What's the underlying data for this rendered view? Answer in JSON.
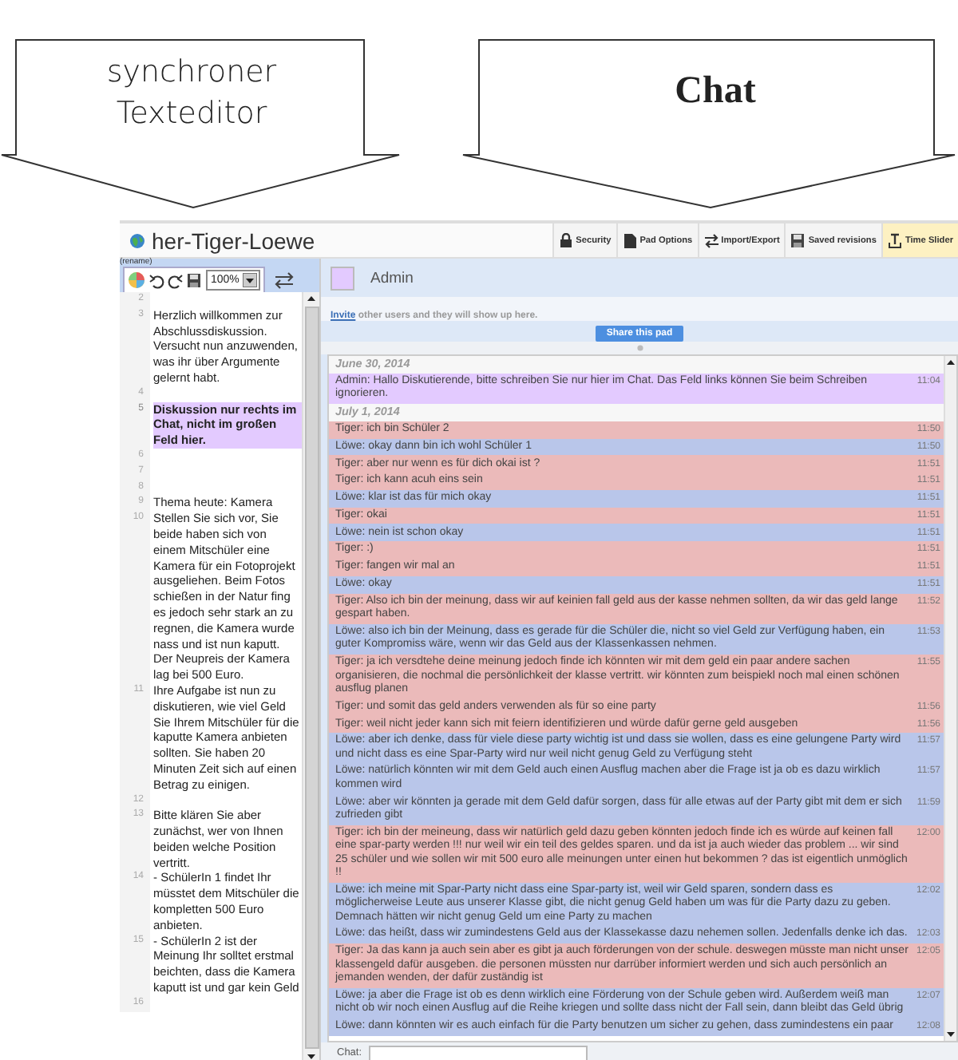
{
  "callouts": [
    {
      "label": "synchroner Texteditor",
      "kind": "plain"
    },
    {
      "label": "Chat",
      "kind": "bold"
    }
  ],
  "pad": {
    "title": "her-Tiger-Loewe",
    "toolbar": [
      {
        "label": "Security",
        "active": false
      },
      {
        "label": "Pad Options",
        "active": false
      },
      {
        "label": "Import/Export",
        "active": false
      },
      {
        "label": "Saved revisions",
        "active": false
      },
      {
        "label": "Time Slider",
        "active": true
      }
    ]
  },
  "editor": {
    "rename": "(rename)",
    "zoom": "100%",
    "lines": [
      {
        "number": "2",
        "highlighted": false
      },
      {
        "number": "3",
        "text": "Herzlich willkommen zur Abschlussdiskussion. Versucht nun anzuwenden, was ihr über Argumente gelernt habt.",
        "highlighted": false
      },
      {
        "number": "4",
        "highlighted": false
      },
      {
        "number": "5",
        "text": "Diskussion nur rechts im Chat, nicht im großen Feld hier.",
        "highlighted": true
      },
      {
        "number": "6",
        "highlighted": false
      },
      {
        "number": "7",
        "highlighted": false
      },
      {
        "number": "8",
        "highlighted": false
      },
      {
        "number": "9",
        "text": "Thema heute: Kamera",
        "highlighted": false
      },
      {
        "number": "10",
        "text": "Stellen Sie sich vor, Sie beide haben sich von einem Mitschüler eine Kamera  für  ein Fotoprojekt ausgeliehen. Beim Fotos schießen in der Natur  fing  es jedoch sehr stark an zu regnen, die Kamera wurde nass und ist  nun kaputt. Der Neupreis der Kamera lag bei 500 Euro.",
        "highlighted": false
      },
      {
        "number": "11",
        "text": "Ihre  Aufgabe ist nun zu diskutieren, wie viel Geld Sie Ihrem Mitschüler für   die kaputte Kamera anbieten sollten. Sie haben 20 Minuten Zeit sich auf  einen Betrag zu einigen.",
        "highlighted": false
      },
      {
        "number": "12",
        "highlighted": false
      },
      {
        "number": "13",
        "text": "Bitte klären Sie aber zunächst, wer von Ihnen beiden welche Position vertritt.",
        "highlighted": false
      },
      {
        "number": "14",
        "text": "- SchülerIn 1 findet Ihr müsstet dem Mitschüler die kompletten 500 Euro anbieten.",
        "highlighted": false
      },
      {
        "number": "15",
        "text": "- SchülerIn 2 ist der Meinung Ihr solltet erstmal beichten, dass die Kamera kaputt ist und gar kein Geld",
        "highlighted": false
      },
      {
        "number": "16",
        "highlighted": false
      }
    ]
  },
  "chat": {
    "user": {
      "name": "Admin",
      "color": "#e3caff"
    },
    "invite_link": "Invite",
    "invite_text": "other users and they will show up here.",
    "share_button": "Share this pad",
    "input_label": "Chat:",
    "days": [
      {
        "date": "June 30, 2014",
        "messages": [
          {
            "text": "Admin: Hallo Diskutierende, bitte schreiben Sie nur hier im Chat. Das Feld links können Sie beim Schreiben ignorieren.",
            "time": "11:04",
            "color": "#e3caff"
          }
        ]
      },
      {
        "date": "July 1, 2014",
        "messages": [
          {
            "text": "Tiger: ich bin Schüler 2",
            "time": "11:50",
            "color": "#ebbaba"
          },
          {
            "text": "Löwe: okay dann bin ich wohl Schüler 1",
            "time": "11:50",
            "color": "#b9c6ea"
          },
          {
            "text": "Tiger: aber nur wenn es für dich okai ist ?",
            "time": "11:51",
            "color": "#ebbaba"
          },
          {
            "text": "Tiger: ich kann acuh eins sein",
            "time": "11:51",
            "color": "#ebbaba"
          },
          {
            "text": "Löwe: klar ist das für mich okay",
            "time": "11:51",
            "color": "#b9c6ea"
          },
          {
            "text": "Tiger: okai",
            "time": "11:51",
            "color": "#ebbaba"
          },
          {
            "text": "Löwe: nein ist schon okay",
            "time": "11:51",
            "color": "#b9c6ea"
          },
          {
            "text": "Tiger: :)",
            "time": "11:51",
            "color": "#ebbaba"
          },
          {
            "text": "Tiger: fangen wir mal an",
            "time": "11:51",
            "color": "#ebbaba"
          },
          {
            "text": "Löwe: okay",
            "time": "11:51",
            "color": "#b9c6ea"
          },
          {
            "text": "Tiger: Also ich bin der meinung, dass wir auf keinien fall geld aus der kasse nehmen sollten, da wir das geld lange gespart haben.",
            "time": "11:52",
            "color": "#ebbaba"
          },
          {
            "text": "Löwe: also ich bin der Meinung, dass es gerade für die Schüler die, nicht so viel Geld zur Verfügung haben, ein guter Kompromiss wäre, wenn wir das Geld aus der Klassenkassen nehmen.",
            "time": "11:53",
            "color": "#b9c6ea"
          },
          {
            "text": "Tiger: ja ich versdtehe deine meinung jedoch finde ich könnten wir mit dem geld ein paar andere sachen organisieren, die nochmal die persönlichkeit der klasse vertritt. wir könnten zum beispiekl noch mal einen schönen ausflug planen",
            "time": "11:55",
            "color": "#ebbaba"
          },
          {
            "text": "Tiger: und somit das geld anders verwenden als für so eine party",
            "time": "11:56",
            "color": "#ebbaba"
          },
          {
            "text": "Tiger: weil nicht jeder kann sich mit feiern identifizieren und würde dafür gerne geld ausgeben",
            "time": "11:56",
            "color": "#ebbaba"
          },
          {
            "text": "Löwe: aber ich denke, dass für viele diese party wichtig ist und dass sie wollen, dass es eine gelungene Party wird und nicht dass es eine Spar-Party wird nur weil nicht genug Geld zu Verfügung steht",
            "time": "11:57",
            "color": "#b9c6ea"
          },
          {
            "text": "Löwe: natürlich könnten wir mit dem Geld auch einen Ausflug machen aber die Frage ist ja ob es dazu wirklich kommen wird",
            "time": "11:57",
            "color": "#b9c6ea"
          },
          {
            "text": "Löwe: aber wir könnten ja gerade mit dem Geld dafür sorgen, dass für alle etwas auf der Party gibt mit dem er sich zufrieden gibt",
            "time": "11:59",
            "color": "#b9c6ea"
          },
          {
            "text": "Tiger: ich bin der meineung, dass wir natürlich geld dazu geben könnten jedoch finde ich es würde auf keinen fall eine spar-party werden !!! nur weil wir ein teil des geldes sparen. und da ist ja auch wieder das problem ... wir sind 25 schüler und wie sollen wir mit 500 euro alle meinungen unter einen hut bekommen ? das ist eigentlich unmöglich !!",
            "time": "12:00",
            "color": "#ebbaba"
          },
          {
            "text": "Löwe: ich meine mit Spar-Party nicht dass eine Spar-party ist, weil wir Geld sparen, sondern dass es möglicherweise Leute aus unserer Klasse gibt, die nicht genug Geld haben um was für die Party dazu zu geben. Demnach hätten wir nicht genug Geld um eine Party zu machen",
            "time": "12:02",
            "color": "#b9c6ea"
          },
          {
            "text": "Löwe: das heißt, dass wir zumindestens Geld aus der Klassekasse dazu nehemen sollen. Jedenfalls denke ich das.",
            "time": "12:03",
            "color": "#b9c6ea"
          },
          {
            "text": "Tiger: Ja das kann ja auch sein aber es gibt ja auch förderungen von der schule. deswegen müsste man nicht unser klassengeld dafür ausgeben. die personen müssten nur darrüber informiert werden und sich auch persönlich an jemanden wenden, der dafür zuständig ist",
            "time": "12:05",
            "color": "#ebbaba"
          },
          {
            "text": "Löwe: ja aber die Frage ist ob es denn wirklich eine Förderung von der Schule geben wird. Außerdem weiß man nicht ob wir noch einen Ausflug auf die Reihe kriegen und sollte dass nicht der Fall sein, dann bleibt das Geld übrig",
            "time": "12:07",
            "color": "#b9c6ea"
          },
          {
            "text": "Löwe: dann könnten wir es auch einfach für die Party benutzen um sicher zu gehen, dass zumindestens ein paar",
            "time": "12:08",
            "color": "#b9c6ea"
          }
        ]
      }
    ]
  }
}
